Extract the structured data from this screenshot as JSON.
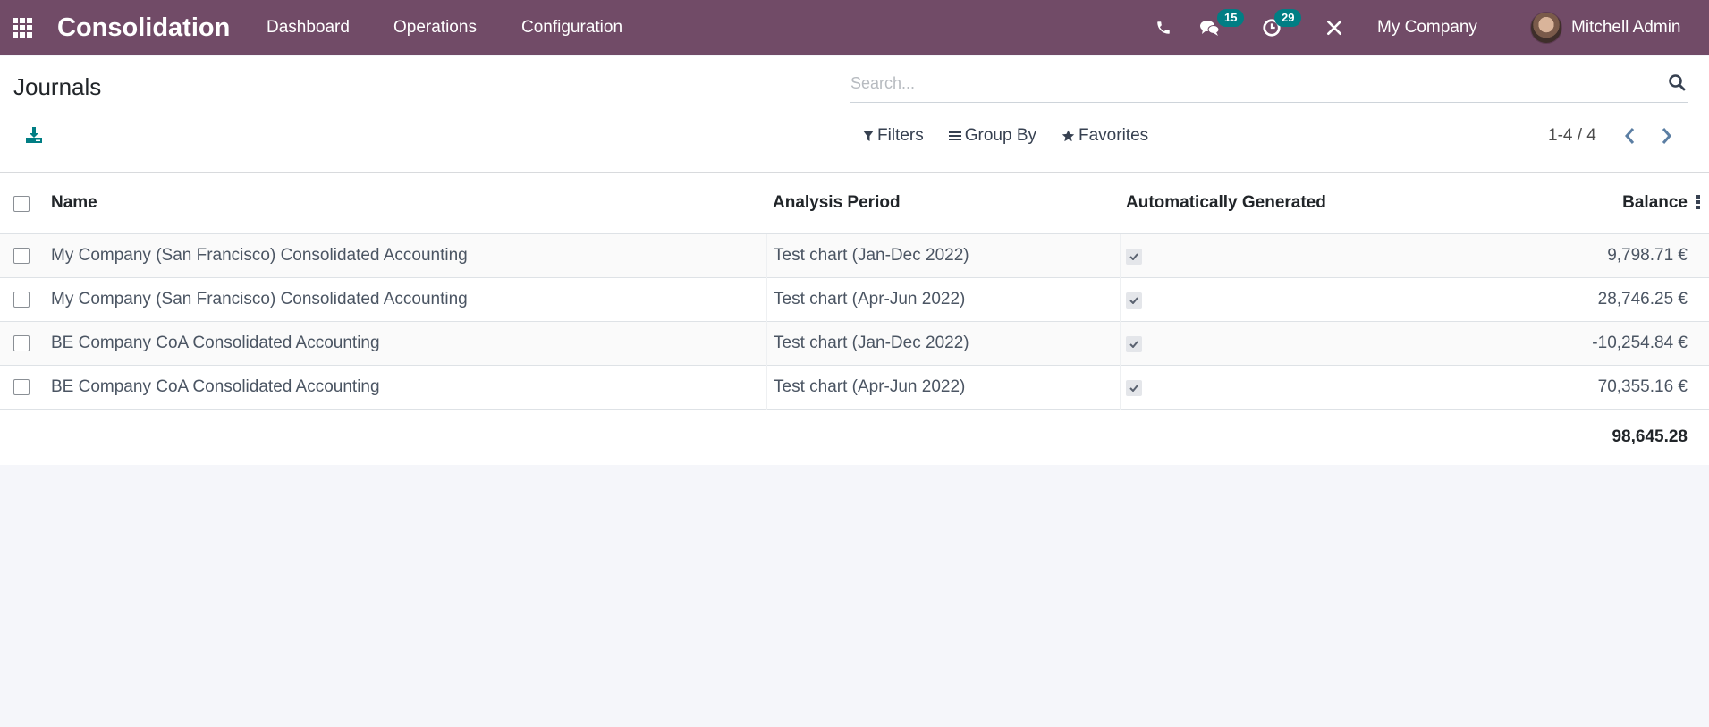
{
  "navbar": {
    "app_name": "Consolidation",
    "menu": [
      "Dashboard",
      "Operations",
      "Configuration"
    ],
    "messages_badge": "15",
    "activities_badge": "29",
    "company": "My Company",
    "user": "Mitchell Admin",
    "color": "#714b67",
    "badge_color": "#017e84"
  },
  "control_panel": {
    "title": "Journals",
    "search_placeholder": "Search...",
    "filters_label": "Filters",
    "groupby_label": "Group By",
    "favorites_label": "Favorites",
    "pager": "1-4 / 4",
    "accent": "#017e84"
  },
  "table": {
    "columns": [
      "Name",
      "Analysis Period",
      "Automatically Generated",
      "Balance"
    ],
    "rows": [
      {
        "name": "My Company (San Francisco) Consolidated Accounting",
        "period": "Test chart (Jan-Dec 2022)",
        "auto": true,
        "balance": "9,798.71 €"
      },
      {
        "name": "My Company (San Francisco) Consolidated Accounting",
        "period": "Test chart (Apr-Jun 2022)",
        "auto": true,
        "balance": "28,746.25 €"
      },
      {
        "name": "BE Company CoA Consolidated Accounting",
        "period": "Test chart (Jan-Dec 2022)",
        "auto": true,
        "balance": "-10,254.84 €"
      },
      {
        "name": "BE Company CoA Consolidated Accounting",
        "period": "Test chart (Apr-Jun 2022)",
        "auto": true,
        "balance": "70,355.16 €"
      }
    ],
    "total": "98,645.28"
  }
}
